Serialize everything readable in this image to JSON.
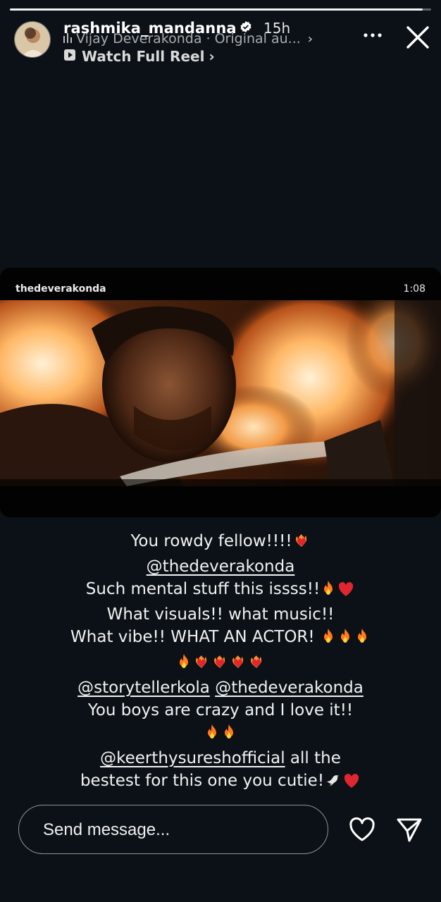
{
  "story": {
    "progress_fraction": 0.98,
    "username": "rashmika_mandanna",
    "time_ago": "15h",
    "music": "Vijay Deverakonda · Original au...",
    "watch_label": "Watch Full Reel"
  },
  "reel": {
    "author": "thedeverakonda",
    "duration": "1:08"
  },
  "caption": {
    "line1": "You rowdy fellow!!!!",
    "mention1": "@thedeverakonda",
    "line3": "Such mental stuff this issss!!",
    "line4": "What visuals!! what music!!",
    "line5": "What vibe!! WHAT AN ACTOR! ",
    "mention2": "@storytellerkola",
    "mention3": "@thedeverakonda",
    "line8": "You boys are crazy and I love it!!",
    "mention4": "@keerthysureshofficial",
    "line9_suffix": " all the",
    "line10": "bestest for this one you cutie!"
  },
  "composer": {
    "placeholder": "Send message..."
  },
  "icons": {
    "verified": "verified-badge-icon",
    "more": "more-dots-icon",
    "close": "close-icon",
    "like": "heart-icon",
    "share": "send-icon",
    "play": "play-icon"
  },
  "colors": {
    "background": "#0b1117",
    "fire": "#ff7a1a",
    "heart_red": "#e0262f"
  }
}
